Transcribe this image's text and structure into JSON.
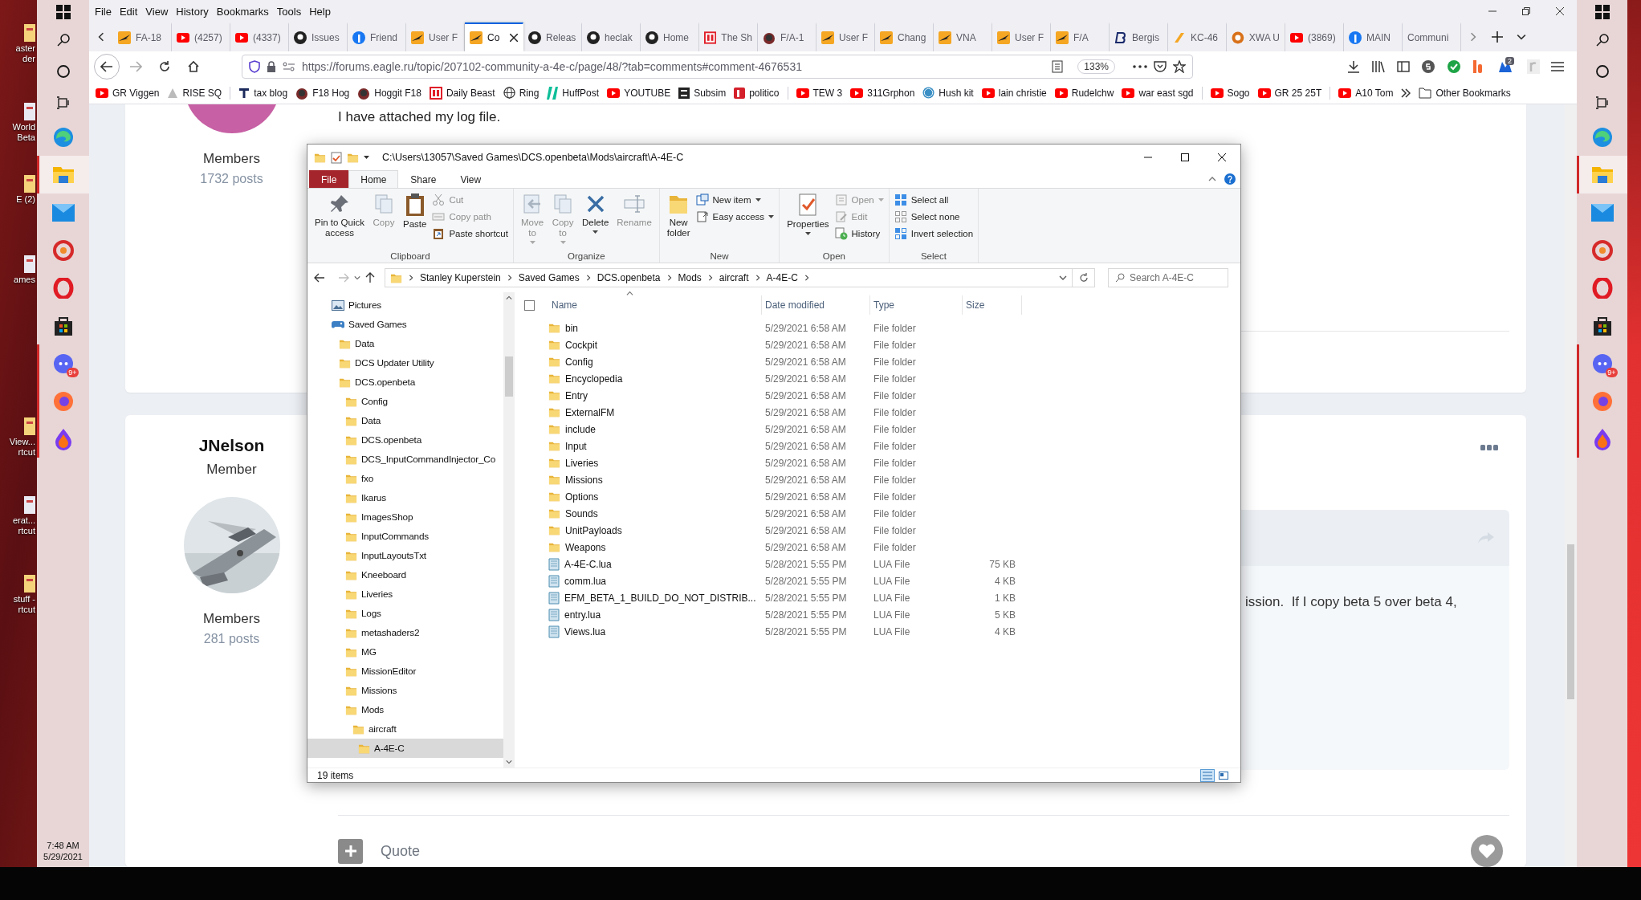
{
  "desktop_left": {
    "icons": [
      {
        "label": "aster\nder"
      },
      {
        "label": "World\nBeta"
      },
      {
        "label": "E (2)"
      },
      {
        "label": "ames"
      },
      {
        "label": "View...\nrtcut"
      },
      {
        "label": "erat...\nrtcut"
      },
      {
        "label": "stuff -\nrtcut"
      }
    ],
    "clock": {
      "time": "7:48 AM",
      "date": "5/29/2021"
    }
  },
  "taskbar_left": {
    "apps": [
      {
        "selected": false,
        "running": false
      },
      {
        "selected": true,
        "running": true
      },
      {
        "selected": false,
        "running": false
      },
      {
        "selected": false,
        "running": false
      },
      {
        "selected": false,
        "running": false
      },
      {
        "selected": false,
        "running": false
      },
      {
        "selected": false,
        "running": true
      },
      {
        "selected": false,
        "running": true
      },
      {
        "selected": false,
        "running": true
      }
    ],
    "badge": "9+"
  },
  "browser": {
    "menu": [
      "File",
      "Edit",
      "View",
      "History",
      "Bookmarks",
      "Tools",
      "Help"
    ],
    "tabs": [
      {
        "label": "FA-18",
        "selected": false
      },
      {
        "label": "(4257)",
        "selected": false
      },
      {
        "label": "(4337)",
        "selected": false
      },
      {
        "label": "Issues",
        "selected": false
      },
      {
        "label": "Friend",
        "selected": false
      },
      {
        "label": "User F",
        "selected": false
      },
      {
        "label": "Co",
        "selected": true
      },
      {
        "label": "Releas",
        "selected": false
      },
      {
        "label": "heclak",
        "selected": false
      },
      {
        "label": "Home",
        "selected": false
      },
      {
        "label": "The Sh",
        "selected": false
      },
      {
        "label": "F/A-1",
        "selected": false
      },
      {
        "label": "User F",
        "selected": false
      },
      {
        "label": "Chang",
        "selected": false
      },
      {
        "label": "VNA",
        "selected": false
      },
      {
        "label": "User F",
        "selected": false
      },
      {
        "label": "F/A",
        "selected": false
      },
      {
        "label": "Bergis",
        "selected": false
      },
      {
        "label": "KC-46",
        "selected": false
      },
      {
        "label": "XWA U",
        "selected": false
      },
      {
        "label": "(3869)",
        "selected": false
      },
      {
        "label": "MAIN",
        "selected": false
      },
      {
        "label": "Communi",
        "selected": false
      }
    ],
    "url": "https://forums.eagle.ru/topic/207102-community-a-4e-c/page/48/?tab=comments#comment-4676531",
    "zoom": "133%",
    "extension_badge": "2",
    "bookmarks": [
      "GR Viggen",
      "RISE SQ",
      "tax blog",
      "F18 Hog",
      "Hoggit F18",
      "Daily Beast",
      "Ring",
      "HuffPost",
      "YOUTUBE",
      "Subsim",
      "politico",
      "TEW 3",
      "311Grphon",
      "Hush kit",
      "lain christie",
      "Rudelchw",
      "war east sgd",
      "Sogo",
      "GR 25 25T",
      "A10 Tom"
    ],
    "other_bookmarks": "Other Bookmarks"
  },
  "forum": {
    "post_1": {
      "author_group": "Members",
      "posts": "1732 posts",
      "text": "I have attached my log file."
    },
    "post_2": {
      "author": "JNelson",
      "rank": "Member",
      "author_group": "Members",
      "posts": "281 posts",
      "quote_text": "ission.  If I copy beta 5 over beta 4,",
      "reply_label": "Quote"
    }
  },
  "explorer": {
    "title": "C:\\Users\\13057\\Saved Games\\DCS.openbeta\\Mods\\aircraft\\A-4E-C",
    "ribbon_tabs": [
      {
        "label": "File",
        "kind": "menu",
        "selected": false
      },
      {
        "label": "Home",
        "kind": "tab",
        "selected": true
      },
      {
        "label": "Share",
        "kind": "tab",
        "selected": false
      },
      {
        "label": "View",
        "kind": "tab",
        "selected": false
      }
    ],
    "ribbon_groups": [
      {
        "name": "Clipboard",
        "commands": [
          {
            "label": "Pin to Quick\naccess",
            "kind": "large",
            "disabled": false
          },
          {
            "label": "Copy",
            "kind": "large",
            "disabled": true
          },
          {
            "label": "Paste",
            "kind": "large",
            "disabled": false
          },
          {
            "label": "Cut",
            "kind": "small",
            "disabled": true
          },
          {
            "label": "Copy path",
            "kind": "small",
            "disabled": true
          },
          {
            "label": "Paste shortcut",
            "kind": "small",
            "disabled": false
          }
        ]
      },
      {
        "name": "Organize",
        "commands": [
          {
            "label": "Move\nto",
            "kind": "large",
            "disabled": true,
            "dropdown": true
          },
          {
            "label": "Copy\nto",
            "kind": "large",
            "disabled": true,
            "dropdown": true
          },
          {
            "label": "Delete",
            "kind": "large",
            "disabled": false,
            "dropdown": true
          },
          {
            "label": "Rename",
            "kind": "large",
            "disabled": true
          }
        ]
      },
      {
        "name": "New",
        "commands": [
          {
            "label": "New\nfolder",
            "kind": "large",
            "disabled": false
          },
          {
            "label": "New item",
            "kind": "small",
            "disabled": false,
            "dropdown": true
          },
          {
            "label": "Easy access",
            "kind": "small",
            "disabled": false,
            "dropdown": true
          }
        ]
      },
      {
        "name": "Open",
        "commands": [
          {
            "label": "Properties",
            "kind": "large",
            "disabled": false,
            "dropdown": true
          },
          {
            "label": "Open",
            "kind": "small",
            "disabled": true,
            "dropdown": true
          },
          {
            "label": "Edit",
            "kind": "small",
            "disabled": true
          },
          {
            "label": "History",
            "kind": "small",
            "disabled": false
          }
        ]
      },
      {
        "name": "Select",
        "commands": [
          {
            "label": "Select all",
            "kind": "small",
            "disabled": false
          },
          {
            "label": "Select none",
            "kind": "small",
            "disabled": false
          },
          {
            "label": "Invert selection",
            "kind": "small",
            "disabled": false
          }
        ]
      }
    ],
    "address": [
      "Stanley Kuperstein",
      "Saved Games",
      "DCS.openbeta",
      "Mods",
      "aircraft",
      "A-4E-C"
    ],
    "search_placeholder": "Search A-4E-C",
    "nav_tree": [
      {
        "label": "Pictures",
        "selected": false
      },
      {
        "label": "Saved Games",
        "selected": false,
        "children": [
          {
            "label": "Data",
            "selected": false
          },
          {
            "label": "DCS Updater Utility",
            "selected": false
          },
          {
            "label": "DCS.openbeta",
            "selected": false,
            "children": [
              {
                "label": "Config",
                "selected": false
              },
              {
                "label": "Data",
                "selected": false
              },
              {
                "label": "DCS.openbeta",
                "selected": false
              },
              {
                "label": "DCS_InputCommandInjector_Co",
                "selected": false
              },
              {
                "label": "fxo",
                "selected": false
              },
              {
                "label": "Ikarus",
                "selected": false
              },
              {
                "label": "ImagesShop",
                "selected": false
              },
              {
                "label": "InputCommands",
                "selected": false
              },
              {
                "label": "InputLayoutsTxt",
                "selected": false
              },
              {
                "label": "Kneeboard",
                "selected": false
              },
              {
                "label": "Liveries",
                "selected": false
              },
              {
                "label": "Logs",
                "selected": false
              },
              {
                "label": "metashaders2",
                "selected": false
              },
              {
                "label": "MG",
                "selected": false
              },
              {
                "label": "MissionEditor",
                "selected": false
              },
              {
                "label": "Missions",
                "selected": false
              },
              {
                "label": "Mods",
                "selected": false,
                "children": [
                  {
                    "label": "aircraft",
                    "selected": false,
                    "children": [
                      {
                        "label": "A-4E-C",
                        "selected": true
                      }
                    ]
                  }
                ]
              }
            ]
          }
        ]
      }
    ],
    "select_all": {
      "checked": false
    },
    "columns": [
      "Name",
      "Date modified",
      "Type",
      "Size"
    ],
    "files": [
      {
        "name": "bin",
        "date": "5/29/2021 6:58 AM",
        "type": "File folder",
        "kind": "folder"
      },
      {
        "name": "Cockpit",
        "date": "5/29/2021 6:58 AM",
        "type": "File folder",
        "kind": "folder"
      },
      {
        "name": "Config",
        "date": "5/29/2021 6:58 AM",
        "type": "File folder",
        "kind": "folder"
      },
      {
        "name": "Encyclopedia",
        "date": "5/29/2021 6:58 AM",
        "type": "File folder",
        "kind": "folder"
      },
      {
        "name": "Entry",
        "date": "5/29/2021 6:58 AM",
        "type": "File folder",
        "kind": "folder"
      },
      {
        "name": "ExternalFM",
        "date": "5/29/2021 6:58 AM",
        "type": "File folder",
        "kind": "folder"
      },
      {
        "name": "include",
        "date": "5/29/2021 6:58 AM",
        "type": "File folder",
        "kind": "folder"
      },
      {
        "name": "Input",
        "date": "5/29/2021 6:58 AM",
        "type": "File folder",
        "kind": "folder"
      },
      {
        "name": "Liveries",
        "date": "5/29/2021 6:58 AM",
        "type": "File folder",
        "kind": "folder"
      },
      {
        "name": "Missions",
        "date": "5/29/2021 6:58 AM",
        "type": "File folder",
        "kind": "folder"
      },
      {
        "name": "Options",
        "date": "5/29/2021 6:58 AM",
        "type": "File folder",
        "kind": "folder"
      },
      {
        "name": "Sounds",
        "date": "5/29/2021 6:58 AM",
        "type": "File folder",
        "kind": "folder"
      },
      {
        "name": "UnitPayloads",
        "date": "5/29/2021 6:58 AM",
        "type": "File folder",
        "kind": "folder"
      },
      {
        "name": "Weapons",
        "date": "5/29/2021 6:58 AM",
        "type": "File folder",
        "kind": "folder"
      },
      {
        "name": "A-4E-C.lua",
        "date": "5/28/2021 5:55 PM",
        "type": "LUA File",
        "size": "75 KB",
        "kind": "file"
      },
      {
        "name": "comm.lua",
        "date": "5/28/2021 5:55 PM",
        "type": "LUA File",
        "size": "4 KB",
        "kind": "file"
      },
      {
        "name": "EFM_BETA_1_BUILD_DO_NOT_DISTRIB...",
        "date": "5/28/2021 5:55 PM",
        "type": "LUA File",
        "size": "1 KB",
        "kind": "file"
      },
      {
        "name": "entry.lua",
        "date": "5/28/2021 5:55 PM",
        "type": "LUA File",
        "size": "5 KB",
        "kind": "file"
      },
      {
        "name": "Views.lua",
        "date": "5/28/2021 5:55 PM",
        "type": "LUA File",
        "size": "4 KB",
        "kind": "file"
      }
    ],
    "status": "19 items",
    "views": [
      {
        "selected": true
      },
      {
        "selected": false
      }
    ]
  },
  "taskbar_right": {
    "apps": [
      {
        "selected": false,
        "running": false
      },
      {
        "selected": true,
        "running": true
      },
      {
        "selected": false,
        "running": false
      },
      {
        "selected": false,
        "running": false
      },
      {
        "selected": false,
        "running": false
      },
      {
        "selected": false,
        "running": false
      },
      {
        "selected": false,
        "running": true
      },
      {
        "selected": false,
        "running": true
      },
      {
        "selected": false,
        "running": true
      }
    ],
    "badge": "9+"
  }
}
